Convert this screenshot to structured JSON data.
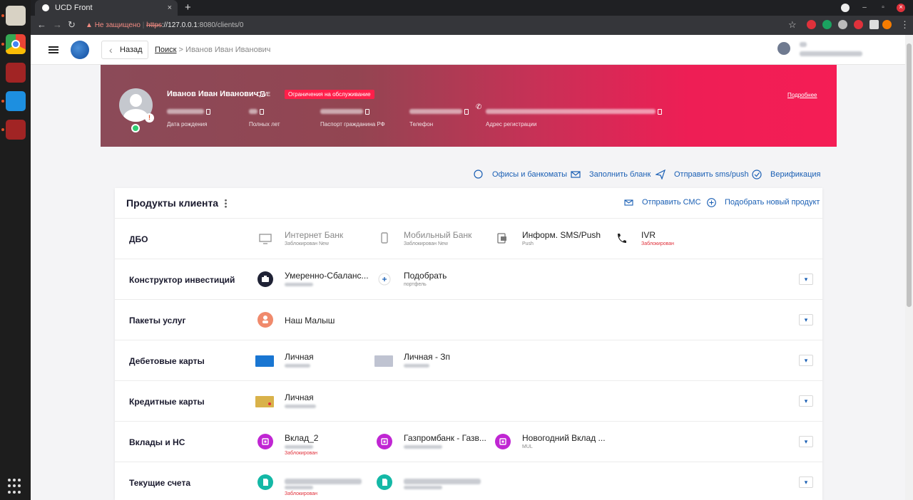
{
  "browser": {
    "tab_title": "UCD Front",
    "tab_close": "×",
    "new_tab": "+",
    "not_secure": "Не защищено",
    "url_scheme": "https",
    "url_host": "://127.0.0.1",
    "url_path": ":8080/clients/0",
    "back": "←",
    "forward": "→",
    "reload": "↻",
    "star": "☆"
  },
  "header": {
    "back_label": "Назад",
    "breadcrumb_search": "Поиск",
    "breadcrumb_sep": ">",
    "breadcrumb_current": "Иванов Иван Иванович",
    "user_name": "",
    "user_role": ""
  },
  "client": {
    "name": "Иванов Иван Иванович",
    "code": "QWE",
    "restriction": "Ограничения на обслуживание",
    "more_link": "Подробнее",
    "fields": [
      {
        "label": "Дата рождения",
        "value": ""
      },
      {
        "label": "Полных лет",
        "value": ""
      },
      {
        "label": "Паспорт гражданина РФ",
        "value": ""
      },
      {
        "label": "Телефон",
        "value": ""
      },
      {
        "label": "Адрес регистрации",
        "value": ""
      }
    ]
  },
  "actions": {
    "offices": "Офисы и банкоматы",
    "fill_form": "Заполнить бланк",
    "send_sms": "Отправить sms/push",
    "verify": "Верификация"
  },
  "products": {
    "title": "Продукты клиента",
    "send_sms": "Отправить СМС",
    "new_product": "Подобрать новый продукт",
    "rows": [
      {
        "title": "ДБО",
        "items": [
          {
            "name": "Интернет Банк",
            "sub": "Заблокирован New",
            "icon": "monitor-icon"
          },
          {
            "name": "Мобильный Банк",
            "sub": "Заблокирован New",
            "icon": "phone-icon"
          },
          {
            "name": "Информ. SMS/Push",
            "sub": "Push",
            "icon": "sms-icon"
          },
          {
            "name": "IVR",
            "sub": "Заблокирован",
            "icon": "call-icon"
          }
        ]
      },
      {
        "title": "Конструктор инвестиций",
        "items": [
          {
            "name": "Умеренно-Сбаланс...",
            "sub": "",
            "icon": "briefcase-icon"
          },
          {
            "name": "Подобрать",
            "sub": "портфель",
            "icon": "plus-icon"
          }
        ]
      },
      {
        "title": "Пакеты услуг",
        "items": [
          {
            "name": "Наш Малыш",
            "sub": "",
            "icon": "baby-icon"
          }
        ]
      },
      {
        "title": "Дебетовые карты",
        "items": [
          {
            "name": "Личная",
            "sub": "",
            "icon": "card-blue-icon"
          },
          {
            "name": "Личная - Зп",
            "sub": "",
            "icon": "card-grey-icon"
          }
        ]
      },
      {
        "title": "Кредитные карты",
        "items": [
          {
            "name": "Личная",
            "sub": "",
            "icon": "card-gold-icon"
          }
        ]
      },
      {
        "title": "Вклады и НС",
        "items": [
          {
            "name": "Вклад_2",
            "sub": "",
            "sub2": "Заблокирован",
            "icon": "deposit-icon"
          },
          {
            "name": "Газпромбанк - Газв...",
            "sub": "",
            "icon": "deposit-icon"
          },
          {
            "name": "Новогодний Вклад ...",
            "sub": "MUL",
            "icon": "deposit-icon"
          }
        ]
      },
      {
        "title": "Текущие счета",
        "items": [
          {
            "name": "",
            "sub": "",
            "sub2": "Заблокирован",
            "icon": "account-icon"
          },
          {
            "name": "",
            "sub": "",
            "icon": "account-icon"
          }
        ]
      }
    ]
  },
  "colors": {
    "accent": "#1a5fb4",
    "banner_start": "#8b4a58",
    "banner_end": "#f51d55",
    "restriction_badge": "#ff1f4a",
    "blocked_text": "#e0313b",
    "deposit_purple": "#c026d3",
    "account_teal": "#14b8a6"
  }
}
